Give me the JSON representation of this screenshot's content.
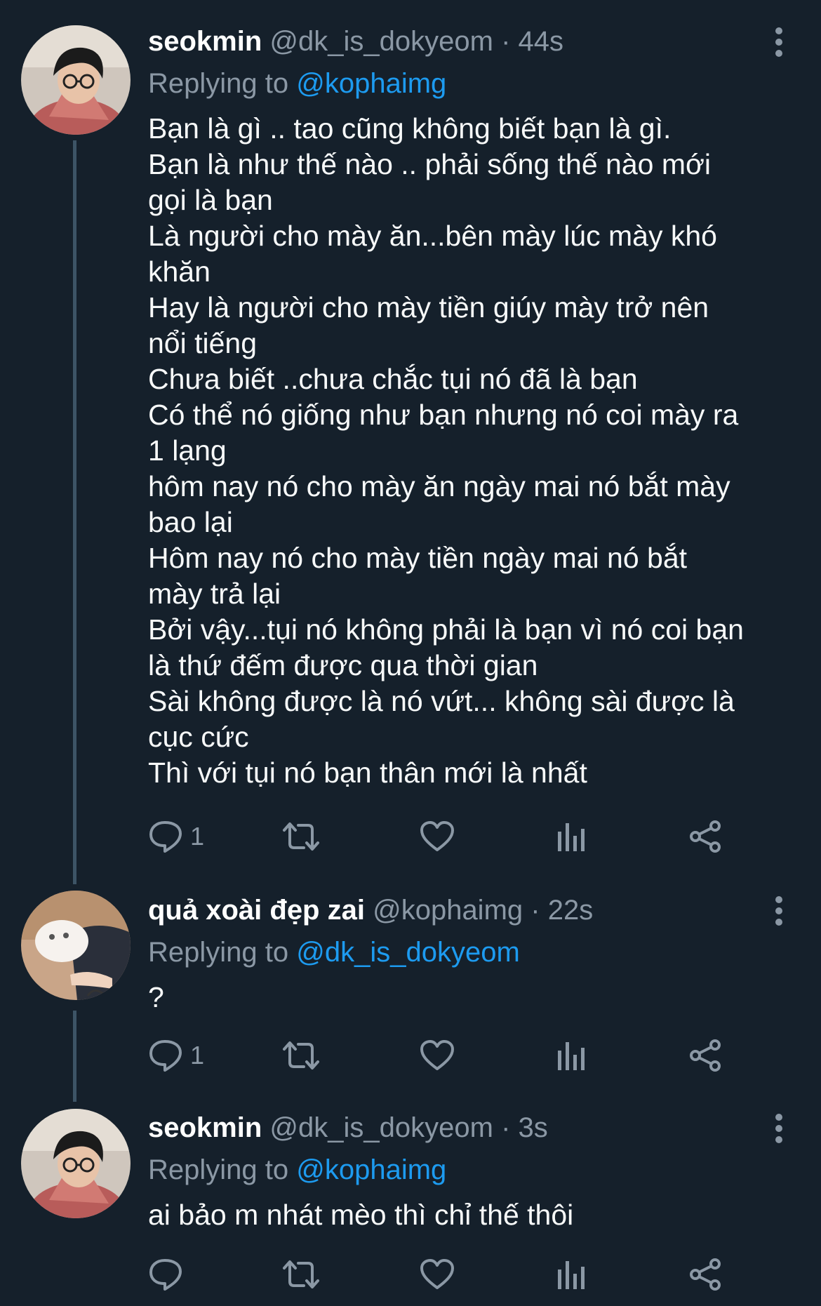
{
  "tweets": [
    {
      "name": "seokmin",
      "handle": "@dk_is_dokyeom",
      "separator": "·",
      "time": "44s",
      "replying_prefix": "Replying to",
      "replying_to": "@kophaimg",
      "lines": [
        "Bạn là gì .. tao cũng không biết bạn là gì.",
        "Bạn là như thế nào .. phải sống thế nào mới",
        "gọi là bạn",
        "Là người cho mày ăn...bên mày lúc mày khó",
        "khăn",
        "Hay là người cho mày tiền giúy mày trở nên",
        "nổi tiếng",
        "Chưa biết ..chưa chắc tụi nó đã là bạn",
        "Có thể nó giống như bạn nhưng nó coi mày ra",
        "1 lạng",
        "hôm nay nó cho mày ăn ngày mai nó bắt mày",
        "bao lại",
        "Hôm nay nó cho mày tiền ngày mai nó bắt",
        "mày trả lại",
        "Bởi vậy...tụi nó không phải là bạn vì nó coi bạn",
        "là thứ đếm được qua thời gian",
        "Sài không được là nó vứt... không sài được là",
        "cục cức",
        "Thì với tụi nó bạn thân mới là nhất"
      ],
      "reply_count": "1"
    },
    {
      "name": "quả xoài đẹp zai",
      "handle": "@kophaimg",
      "separator": "·",
      "time": "22s",
      "replying_prefix": "Replying to",
      "replying_to": "@dk_is_dokyeom",
      "lines": [
        "?"
      ],
      "reply_count": "1"
    },
    {
      "name": "seokmin",
      "handle": "@dk_is_dokyeom",
      "separator": "·",
      "time": "3s",
      "replying_prefix": "Replying to",
      "replying_to": "@kophaimg",
      "lines": [
        "ai bảo m nhát mèo thì chỉ thế thôi"
      ],
      "reply_count": ""
    }
  ],
  "colors": {
    "background": "#15202b",
    "text": "#f7f9f9",
    "secondary": "#8b98a5",
    "link": "#1d9bf0",
    "thread_line": "#3d5466"
  },
  "icons": {
    "reply": "reply-icon",
    "retweet": "retweet-icon",
    "like": "heart-icon",
    "views": "views-chart-icon",
    "share": "share-icon",
    "more": "more-options-icon"
  }
}
